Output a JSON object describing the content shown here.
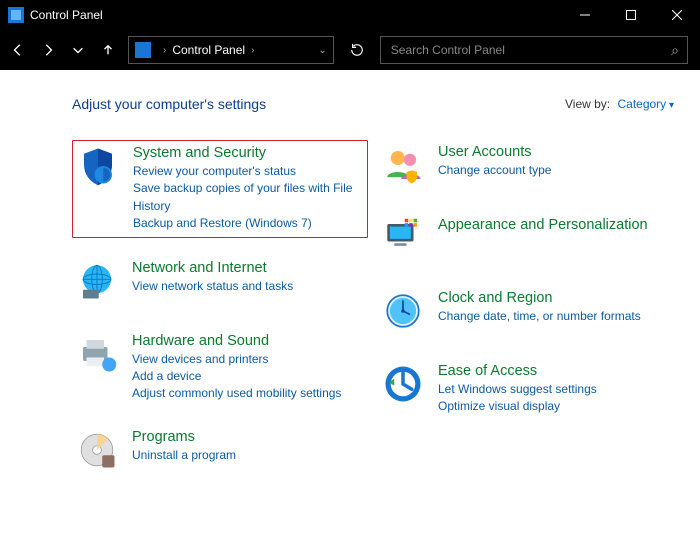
{
  "window": {
    "title": "Control Panel"
  },
  "breadcrumb": {
    "root": "Control Panel"
  },
  "search": {
    "placeholder": "Search Control Panel"
  },
  "heading": "Adjust your computer's settings",
  "viewby": {
    "label": "View by:",
    "value": "Category"
  },
  "left": [
    {
      "title": "System and Security",
      "links": [
        "Review your computer's status",
        "Save backup copies of your files with File History",
        "Backup and Restore (Windows 7)"
      ],
      "highlight": true
    },
    {
      "title": "Network and Internet",
      "links": [
        "View network status and tasks"
      ]
    },
    {
      "title": "Hardware and Sound",
      "links": [
        "View devices and printers",
        "Add a device",
        "Adjust commonly used mobility settings"
      ]
    },
    {
      "title": "Programs",
      "links": [
        "Uninstall a program"
      ]
    }
  ],
  "right": [
    {
      "title": "User Accounts",
      "links": [
        "Change account type"
      ]
    },
    {
      "title": "Appearance and Personalization",
      "links": []
    },
    {
      "title": "Clock and Region",
      "links": [
        "Change date, time, or number formats"
      ]
    },
    {
      "title": "Ease of Access",
      "links": [
        "Let Windows suggest settings",
        "Optimize visual display"
      ]
    }
  ]
}
